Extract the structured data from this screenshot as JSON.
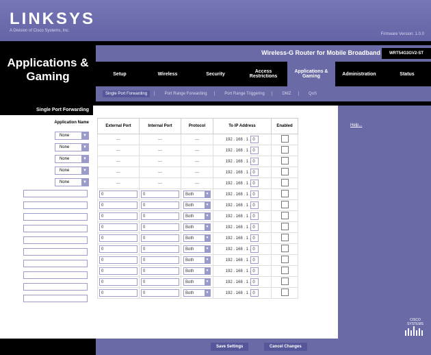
{
  "header": {
    "logo": "LINKSYS",
    "logo_sub": "A Division of Cisco Systems, Inc.",
    "firmware": "Firmware Version: 1.0.0",
    "product": "Wireless-G Router for Mobile Broadband",
    "model": "WRT54G3GV2-ST",
    "section_title_line1": "Applications &",
    "section_title_line2": "Gaming"
  },
  "tabs": [
    {
      "label": "Setup"
    },
    {
      "label": "Wireless"
    },
    {
      "label": "Security"
    },
    {
      "label": "Access Restrictions"
    },
    {
      "label": "Applications & Gaming"
    },
    {
      "label": "Administration"
    },
    {
      "label": "Status"
    }
  ],
  "subtabs": [
    {
      "label": "Single Port Forwarding"
    },
    {
      "label": "Port Range Forwarding"
    },
    {
      "label": "Port Range Triggering"
    },
    {
      "label": "DMZ"
    },
    {
      "label": "QoS"
    }
  ],
  "left": {
    "section_label": "Single Port Forwarding",
    "app_name_header": "Application Name",
    "app_selects": [
      "None",
      "None",
      "None",
      "None",
      "None"
    ]
  },
  "table": {
    "headers": {
      "ext": "External Port",
      "int": "Internal Port",
      "proto": "Protocol",
      "ip": "To IP Address",
      "enabled": "Enabled"
    },
    "dash": "---",
    "ip_prefix": "192 . 168 . 1 .",
    "ip_last": "0",
    "rows": [
      {
        "ext": "0",
        "int": "0",
        "proto": "Both"
      },
      {
        "ext": "0",
        "int": "0",
        "proto": "Both"
      },
      {
        "ext": "0",
        "int": "0",
        "proto": "Both"
      },
      {
        "ext": "0",
        "int": "0",
        "proto": "Both"
      },
      {
        "ext": "0",
        "int": "0",
        "proto": "Both"
      },
      {
        "ext": "0",
        "int": "0",
        "proto": "Both"
      },
      {
        "ext": "0",
        "int": "0",
        "proto": "Both"
      },
      {
        "ext": "0",
        "int": "0",
        "proto": "Both"
      },
      {
        "ext": "0",
        "int": "0",
        "proto": "Both"
      },
      {
        "ext": "0",
        "int": "0",
        "proto": "Both"
      }
    ]
  },
  "help": {
    "label": "Help..."
  },
  "brand": {
    "cisco": "CISCO SYSTEMS"
  },
  "footer": {
    "save": "Save Settings",
    "cancel": "Cancel Changes"
  }
}
